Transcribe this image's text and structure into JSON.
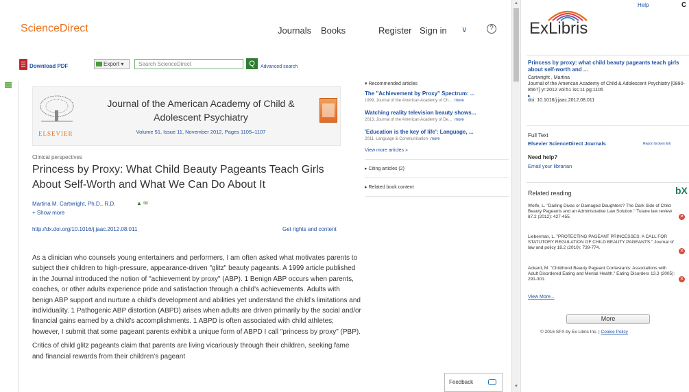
{
  "sciencedirect": {
    "logo": "ScienceDirect",
    "nav": {
      "journals": "Journals",
      "books": "Books",
      "register": "Register",
      "signin": "Sign in",
      "help_symbol": "?"
    },
    "toolbar": {
      "download_pdf": "Download PDF",
      "export": "Export",
      "search_placeholder": "Search ScienceDirect",
      "search_button": "Q",
      "advanced_search": "Advanced search"
    },
    "journal": {
      "elsevier_label": "ELSEVIER",
      "title": "Journal of the American Academy of Child & Adolescent Psychiatry",
      "volume_line": "Volume 51, Issue 11, November 2012, Pages 1105–1107"
    },
    "article": {
      "type": "Clinical perspectives",
      "title": "Princess by Proxy: What Child Beauty Pageants Teach Girls About Self-Worth and What We Can Do About It",
      "author": "Martina M. Cartwright, Ph.D., R.D.",
      "show_more": "Show more",
      "doi": "http://dx.doi.org/10.1016/j.jaac.2012.08.011",
      "rights": "Get rights and content",
      "paragraph1": "As a clinician who counsels young entertainers and performers, I am often asked what motivates parents to subject their children to high-pressure, appearance-driven \"glitz\" beauty pageants. A 1999 article published in the Journal introduced the notion of \"achievement by proxy\" (ABP). 1 Benign ABP occurs when parents, coaches, or other adults experience pride and satisfaction through a child's achievements. Adults with benign ABP support and nurture a child's development and abilities yet understand the child's limitations and individuality. 1 Pathogenic ABP distortion (ABPD) arises when adults are driven primarily by the social and/or financial gains earned by a child's accomplishments. 1 ABPD is often associated with child athletes; however, I submit that some pageant parents exhibit a unique form of ABPD I call \"princess by proxy\" (PBP).",
      "paragraph2": "Critics of child glitz pageants claim that parents are living vicariously through their children, seeking fame and financial rewards from their children's pageant"
    },
    "recommended": {
      "heading": "Recommended articles",
      "items": [
        {
          "title": "The \"Achievement by Proxy\" Spectrum: ...",
          "meta": "1999, Journal of the American Academy of Ch...",
          "more": "more"
        },
        {
          "title": "Watching reality television beauty shows...",
          "meta": "2013, Journal of the American Academy of De...",
          "more": "more"
        },
        {
          "title": "'Education is the key of life': Language, ...",
          "meta": "2011, Language & Communication",
          "more": "more"
        }
      ],
      "view_more": "View more articles »"
    },
    "citing": "Citing articles (2)",
    "related_book": "Related book content",
    "feedback": "Feedback"
  },
  "exlibris": {
    "logo": "ExLibris",
    "help": "Help",
    "corner_icon": "C",
    "title": "Princess by proxy: what child beauty pageants teach girls about self-worth and ...",
    "author": "Cartwright , Martina",
    "source": "Journal of the American Academy of Child & Adolescent Psychiatry [0890-8567] yr:2012 vol:51 iss:11 pg:1105",
    "doi": "doi: 10.1016/j.jaac.2012.08.011",
    "full_text_label": "Full Text",
    "full_text_link": "Elsevier ScienceDirect Journals",
    "report_broken": "Report broken link",
    "need_help": "Need help?",
    "email": "Email your librarian",
    "related_reading": "Related reading",
    "bx": "bX",
    "refs": [
      "Wolfe, L. \"Darling Divas or Damaged Daughters? The Dark Side of Child Beauty Pageants and an Administrative Law Solution.\" Tulane law review 87.2 (2012): 427-455.",
      "Lieberman, L. \"PROTECTING PAGEANT PRINCESSES: A CALL FOR STATUTORY REGULATION OF CHILD BEAUTY PAGEANTS.\" Journal of law and policy 18.2 (2010): 739-774.",
      "Ackard, M. \"Childhood Beauty Pageant Contestants: Associations with Adult Disordered Eating and Mental Health.\" Eating Disorders 13.3 (2005): 291-301."
    ],
    "view_more": "View More...",
    "more_button": "More",
    "footer_text": "© 2016 SFX by Ex Libris Inc. |",
    "cookie_policy": "Cookie Policy"
  }
}
